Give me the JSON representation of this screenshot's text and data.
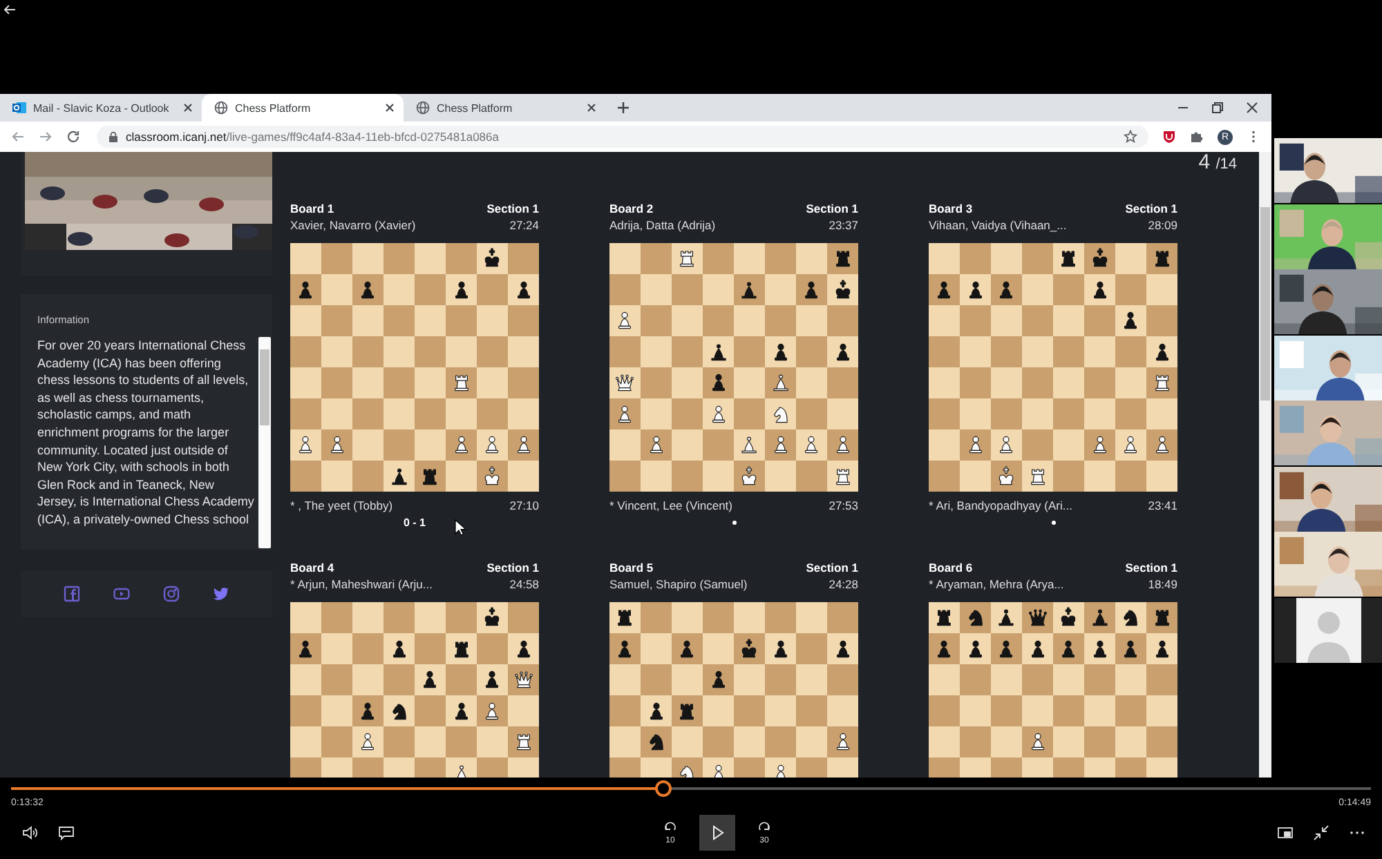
{
  "browser": {
    "tabs": [
      {
        "title": "Mail - Slavic Koza - Outlook",
        "kind": "mail",
        "selected": false
      },
      {
        "title": "Chess Platform",
        "kind": "web",
        "selected": true
      },
      {
        "title": "Chess Platform",
        "kind": "web",
        "selected": false
      }
    ],
    "address_host": "classroom.icanj.net",
    "address_path": "/live-games/ff9c4af4-83a4-11eb-bfcd-0275481a086a",
    "profile_initial": "R"
  },
  "sidebar": {
    "video": {
      "kind": "picture"
    },
    "information_title": "Information",
    "information_text": "For over 20 years International Chess Academy (ICA) has been offering chess lessons to students of all levels, as well as chess tournaments, scholastic camps, and math enrichment programs for the larger community. Located just outside of New York City, with schools in both Glen Rock and in Teaneck, New Jersey, is International Chess Academy (ICA), a privately-owned Chess school",
    "socials": [
      {
        "kind": "facebook"
      },
      {
        "kind": "youtube"
      },
      {
        "kind": "instagram"
      },
      {
        "kind": "twitter"
      }
    ]
  },
  "games": {
    "page": "4",
    "page_total": "/14",
    "boards": [
      {
        "title": "Board 1",
        "section": "Section 1",
        "top_player": "Xavier, Navarro (Xavier)",
        "top_clock": "27:24",
        "bottom_player": "* , The yeet (Tobby)",
        "bottom_clock": "27:10",
        "result": "0 - 1",
        "in_progress": false,
        "rows": [
          [
            {
              "kind": "empty"
            },
            {
              "kind": "empty"
            },
            {
              "kind": "empty"
            },
            {
              "kind": "empty"
            },
            {
              "kind": "empty"
            },
            {
              "kind": "empty"
            },
            {
              "kind": "king",
              "black": true
            },
            {
              "kind": "empty"
            }
          ],
          [
            {
              "kind": "pawn",
              "black": true
            },
            {
              "kind": "empty"
            },
            {
              "kind": "pawn",
              "black": true
            },
            {
              "kind": "empty"
            },
            {
              "kind": "empty"
            },
            {
              "kind": "pawn",
              "black": true
            },
            {
              "kind": "empty"
            },
            {
              "kind": "pawn",
              "black": true
            }
          ],
          [
            {
              "kind": "empty"
            },
            {
              "kind": "empty"
            },
            {
              "kind": "empty"
            },
            {
              "kind": "empty"
            },
            {
              "kind": "empty"
            },
            {
              "kind": "empty"
            },
            {
              "kind": "empty"
            },
            {
              "kind": "empty"
            }
          ],
          [
            {
              "kind": "empty"
            },
            {
              "kind": "empty"
            },
            {
              "kind": "empty"
            },
            {
              "kind": "empty"
            },
            {
              "kind": "empty"
            },
            {
              "kind": "empty"
            },
            {
              "kind": "empty"
            },
            {
              "kind": "empty"
            }
          ],
          [
            {
              "kind": "empty"
            },
            {
              "kind": "empty"
            },
            {
              "kind": "empty"
            },
            {
              "kind": "empty"
            },
            {
              "kind": "empty"
            },
            {
              "kind": "rook",
              "black": false
            },
            {
              "kind": "empty"
            },
            {
              "kind": "empty"
            }
          ],
          [
            {
              "kind": "empty"
            },
            {
              "kind": "empty"
            },
            {
              "kind": "empty"
            },
            {
              "kind": "empty"
            },
            {
              "kind": "empty"
            },
            {
              "kind": "empty"
            },
            {
              "kind": "empty"
            },
            {
              "kind": "empty"
            }
          ],
          [
            {
              "kind": "pawn",
              "black": false
            },
            {
              "kind": "pawn",
              "black": false
            },
            {
              "kind": "empty"
            },
            {
              "kind": "empty"
            },
            {
              "kind": "empty"
            },
            {
              "kind": "pawn",
              "black": false
            },
            {
              "kind": "pawn",
              "black": false
            },
            {
              "kind": "pawn",
              "black": false
            }
          ],
          [
            {
              "kind": "empty"
            },
            {
              "kind": "empty"
            },
            {
              "kind": "empty"
            },
            {
              "kind": "bishop",
              "black": true
            },
            {
              "kind": "rook",
              "black": true
            },
            {
              "kind": "empty"
            },
            {
              "kind": "king",
              "black": false
            },
            {
              "kind": "empty"
            }
          ]
        ]
      },
      {
        "title": "Board 2",
        "section": "Section 1",
        "top_player": "Adrija, Datta (Adrija)",
        "top_clock": "23:37",
        "bottom_player": "* Vincent, Lee (Vincent)",
        "bottom_clock": "27:53",
        "in_progress": true,
        "rows": [
          [
            {
              "kind": "empty"
            },
            {
              "kind": "empty"
            },
            {
              "kind": "rook",
              "black": false
            },
            {
              "kind": "empty"
            },
            {
              "kind": "empty"
            },
            {
              "kind": "empty"
            },
            {
              "kind": "empty"
            },
            {
              "kind": "rook",
              "black": true
            }
          ],
          [
            {
              "kind": "empty"
            },
            {
              "kind": "empty"
            },
            {
              "kind": "empty"
            },
            {
              "kind": "empty"
            },
            {
              "kind": "bishop",
              "black": true
            },
            {
              "kind": "empty"
            },
            {
              "kind": "pawn",
              "black": true
            },
            {
              "kind": "king",
              "black": true
            }
          ],
          [
            {
              "kind": "pawn",
              "black": false
            },
            {
              "kind": "empty"
            },
            {
              "kind": "empty"
            },
            {
              "kind": "empty"
            },
            {
              "kind": "empty"
            },
            {
              "kind": "empty"
            },
            {
              "kind": "empty"
            },
            {
              "kind": "empty"
            }
          ],
          [
            {
              "kind": "empty"
            },
            {
              "kind": "empty"
            },
            {
              "kind": "empty"
            },
            {
              "kind": "bishop",
              "black": true
            },
            {
              "kind": "empty"
            },
            {
              "kind": "pawn",
              "black": true
            },
            {
              "kind": "empty"
            },
            {
              "kind": "pawn",
              "black": true
            }
          ],
          [
            {
              "kind": "queen",
              "black": false
            },
            {
              "kind": "empty"
            },
            {
              "kind": "empty"
            },
            {
              "kind": "pawn",
              "black": true
            },
            {
              "kind": "empty"
            },
            {
              "kind": "bishop",
              "black": false
            },
            {
              "kind": "empty"
            },
            {
              "kind": "empty"
            }
          ],
          [
            {
              "kind": "pawn",
              "black": false
            },
            {
              "kind": "empty"
            },
            {
              "kind": "empty"
            },
            {
              "kind": "pawn",
              "black": false
            },
            {
              "kind": "empty"
            },
            {
              "kind": "knight",
              "black": false
            },
            {
              "kind": "empty"
            },
            {
              "kind": "empty"
            }
          ],
          [
            {
              "kind": "empty"
            },
            {
              "kind": "pawn",
              "black": false
            },
            {
              "kind": "empty"
            },
            {
              "kind": "empty"
            },
            {
              "kind": "bishop",
              "black": false
            },
            {
              "kind": "pawn",
              "black": false
            },
            {
              "kind": "pawn",
              "black": false
            },
            {
              "kind": "pawn",
              "black": false
            }
          ],
          [
            {
              "kind": "empty"
            },
            {
              "kind": "empty"
            },
            {
              "kind": "empty"
            },
            {
              "kind": "empty"
            },
            {
              "kind": "king",
              "black": false
            },
            {
              "kind": "empty"
            },
            {
              "kind": "empty"
            },
            {
              "kind": "rook",
              "black": false
            }
          ]
        ]
      },
      {
        "title": "Board 3",
        "section": "Section 1",
        "top_player": "Vihaan, Vaidya (Vihaan_...",
        "top_clock": "28:09",
        "bottom_player": "* Ari, Bandyopadhyay (Ari...",
        "bottom_clock": "23:41",
        "in_progress": true,
        "rows": [
          [
            {
              "kind": "empty"
            },
            {
              "kind": "empty"
            },
            {
              "kind": "empty"
            },
            {
              "kind": "empty"
            },
            {
              "kind": "rook",
              "black": true
            },
            {
              "kind": "king",
              "black": true
            },
            {
              "kind": "empty"
            },
            {
              "kind": "rook",
              "black": true
            }
          ],
          [
            {
              "kind": "pawn",
              "black": true
            },
            {
              "kind": "pawn",
              "black": true
            },
            {
              "kind": "pawn",
              "black": true
            },
            {
              "kind": "empty"
            },
            {
              "kind": "empty"
            },
            {
              "kind": "pawn",
              "black": true
            },
            {
              "kind": "empty"
            },
            {
              "kind": "empty"
            }
          ],
          [
            {
              "kind": "empty"
            },
            {
              "kind": "empty"
            },
            {
              "kind": "empty"
            },
            {
              "kind": "empty"
            },
            {
              "kind": "empty"
            },
            {
              "kind": "empty"
            },
            {
              "kind": "pawn",
              "black": true
            },
            {
              "kind": "empty"
            }
          ],
          [
            {
              "kind": "empty"
            },
            {
              "kind": "empty"
            },
            {
              "kind": "empty"
            },
            {
              "kind": "empty"
            },
            {
              "kind": "empty"
            },
            {
              "kind": "empty"
            },
            {
              "kind": "empty"
            },
            {
              "kind": "pawn",
              "black": true
            }
          ],
          [
            {
              "kind": "empty"
            },
            {
              "kind": "empty"
            },
            {
              "kind": "empty"
            },
            {
              "kind": "empty"
            },
            {
              "kind": "empty"
            },
            {
              "kind": "empty"
            },
            {
              "kind": "empty"
            },
            {
              "kind": "rook",
              "black": false
            }
          ],
          [
            {
              "kind": "empty"
            },
            {
              "kind": "empty"
            },
            {
              "kind": "empty"
            },
            {
              "kind": "empty"
            },
            {
              "kind": "empty"
            },
            {
              "kind": "empty"
            },
            {
              "kind": "empty"
            },
            {
              "kind": "empty"
            }
          ],
          [
            {
              "kind": "empty"
            },
            {
              "kind": "pawn",
              "black": false
            },
            {
              "kind": "pawn",
              "black": false
            },
            {
              "kind": "empty"
            },
            {
              "kind": "empty"
            },
            {
              "kind": "pawn",
              "black": false
            },
            {
              "kind": "pawn",
              "black": false
            },
            {
              "kind": "pawn",
              "black": false
            }
          ],
          [
            {
              "kind": "empty"
            },
            {
              "kind": "empty"
            },
            {
              "kind": "king",
              "black": false
            },
            {
              "kind": "rook",
              "black": false
            },
            {
              "kind": "empty"
            },
            {
              "kind": "empty"
            },
            {
              "kind": "empty"
            },
            {
              "kind": "empty"
            }
          ]
        ]
      },
      {
        "title": "Board 4",
        "section": "Section 1",
        "top_player": "* Arjun, Maheshwari (Arju...",
        "top_clock": "24:58",
        "rows": [
          [
            {
              "kind": "empty"
            },
            {
              "kind": "empty"
            },
            {
              "kind": "empty"
            },
            {
              "kind": "empty"
            },
            {
              "kind": "empty"
            },
            {
              "kind": "empty"
            },
            {
              "kind": "king",
              "black": true
            },
            {
              "kind": "empty"
            }
          ],
          [
            {
              "kind": "pawn",
              "black": true
            },
            {
              "kind": "empty"
            },
            {
              "kind": "empty"
            },
            {
              "kind": "pawn",
              "black": true
            },
            {
              "kind": "empty"
            },
            {
              "kind": "rook",
              "black": true
            },
            {
              "kind": "empty"
            },
            {
              "kind": "pawn",
              "black": true
            }
          ],
          [
            {
              "kind": "empty"
            },
            {
              "kind": "empty"
            },
            {
              "kind": "empty"
            },
            {
              "kind": "empty"
            },
            {
              "kind": "pawn",
              "black": true
            },
            {
              "kind": "empty"
            },
            {
              "kind": "pawn",
              "black": true
            },
            {
              "kind": "queen",
              "black": false
            }
          ],
          [
            {
              "kind": "empty"
            },
            {
              "kind": "empty"
            },
            {
              "kind": "pawn",
              "black": true
            },
            {
              "kind": "knight",
              "black": true
            },
            {
              "kind": "empty"
            },
            {
              "kind": "pawn",
              "black": true
            },
            {
              "kind": "pawn",
              "black": false
            },
            {
              "kind": "empty"
            }
          ],
          [
            {
              "kind": "empty"
            },
            {
              "kind": "empty"
            },
            {
              "kind": "pawn",
              "black": false
            },
            {
              "kind": "empty"
            },
            {
              "kind": "empty"
            },
            {
              "kind": "empty"
            },
            {
              "kind": "empty"
            },
            {
              "kind": "rook",
              "black": false
            }
          ],
          [
            {
              "kind": "empty"
            },
            {
              "kind": "empty"
            },
            {
              "kind": "empty"
            },
            {
              "kind": "empty"
            },
            {
              "kind": "empty"
            },
            {
              "kind": "bishop",
              "black": false
            },
            {
              "kind": "empty"
            },
            {
              "kind": "empty"
            }
          ]
        ]
      },
      {
        "title": "Board 5",
        "section": "Section 1",
        "top_player": "Samuel, Shapiro (Samuel)",
        "top_clock": "24:28",
        "rows": [
          [
            {
              "kind": "rook",
              "black": true
            },
            {
              "kind": "empty"
            },
            {
              "kind": "empty"
            },
            {
              "kind": "empty"
            },
            {
              "kind": "empty"
            },
            {
              "kind": "empty"
            },
            {
              "kind": "empty"
            },
            {
              "kind": "empty"
            }
          ],
          [
            {
              "kind": "pawn",
              "black": true
            },
            {
              "kind": "empty"
            },
            {
              "kind": "pawn",
              "black": true
            },
            {
              "kind": "empty"
            },
            {
              "kind": "king",
              "black": true
            },
            {
              "kind": "pawn",
              "black": true
            },
            {
              "kind": "empty"
            },
            {
              "kind": "pawn",
              "black": true
            }
          ],
          [
            {
              "kind": "empty"
            },
            {
              "kind": "empty"
            },
            {
              "kind": "empty"
            },
            {
              "kind": "pawn",
              "black": true
            },
            {
              "kind": "empty"
            },
            {
              "kind": "empty"
            },
            {
              "kind": "empty"
            },
            {
              "kind": "empty"
            }
          ],
          [
            {
              "kind": "empty"
            },
            {
              "kind": "pawn",
              "black": true
            },
            {
              "kind": "rook",
              "black": true
            },
            {
              "kind": "empty"
            },
            {
              "kind": "empty"
            },
            {
              "kind": "empty"
            },
            {
              "kind": "empty"
            },
            {
              "kind": "empty"
            }
          ],
          [
            {
              "kind": "empty"
            },
            {
              "kind": "knight",
              "black": true
            },
            {
              "kind": "empty"
            },
            {
              "kind": "empty"
            },
            {
              "kind": "empty"
            },
            {
              "kind": "empty"
            },
            {
              "kind": "empty"
            },
            {
              "kind": "pawn",
              "black": false
            }
          ],
          [
            {
              "kind": "empty"
            },
            {
              "kind": "empty"
            },
            {
              "kind": "knight",
              "black": false
            },
            {
              "kind": "pawn",
              "black": false
            },
            {
              "kind": "empty"
            },
            {
              "kind": "pawn",
              "black": false
            },
            {
              "kind": "empty"
            },
            {
              "kind": "empty"
            }
          ]
        ]
      },
      {
        "title": "Board 6",
        "section": "Section 1",
        "top_player": "* Aryaman, Mehra (Arya...",
        "top_clock": "18:49",
        "rows": [
          [
            {
              "kind": "rook",
              "black": true
            },
            {
              "kind": "knight",
              "black": true
            },
            {
              "kind": "bishop",
              "black": true
            },
            {
              "kind": "queen",
              "black": true
            },
            {
              "kind": "king",
              "black": true
            },
            {
              "kind": "bishop",
              "black": true
            },
            {
              "kind": "knight",
              "black": true
            },
            {
              "kind": "rook",
              "black": true
            }
          ],
          [
            {
              "kind": "pawn",
              "black": true
            },
            {
              "kind": "pawn",
              "black": true
            },
            {
              "kind": "pawn",
              "black": true
            },
            {
              "kind": "pawn",
              "black": true
            },
            {
              "kind": "pawn",
              "black": true
            },
            {
              "kind": "pawn",
              "black": true
            },
            {
              "kind": "pawn",
              "black": true
            },
            {
              "kind": "pawn",
              "black": true
            }
          ],
          [
            {
              "kind": "empty"
            },
            {
              "kind": "empty"
            },
            {
              "kind": "empty"
            },
            {
              "kind": "empty"
            },
            {
              "kind": "empty"
            },
            {
              "kind": "empty"
            },
            {
              "kind": "empty"
            },
            {
              "kind": "empty"
            }
          ],
          [
            {
              "kind": "empty"
            },
            {
              "kind": "empty"
            },
            {
              "kind": "empty"
            },
            {
              "kind": "empty"
            },
            {
              "kind": "empty"
            },
            {
              "kind": "empty"
            },
            {
              "kind": "empty"
            },
            {
              "kind": "empty"
            }
          ],
          [
            {
              "kind": "empty"
            },
            {
              "kind": "empty"
            },
            {
              "kind": "empty"
            },
            {
              "kind": "pawn",
              "black": false
            },
            {
              "kind": "empty"
            },
            {
              "kind": "empty"
            },
            {
              "kind": "empty"
            },
            {
              "kind": "empty"
            }
          ]
        ]
      }
    ]
  },
  "participants": [
    {
      "kind": "picture"
    },
    {
      "kind": "picture"
    },
    {
      "kind": "picture"
    },
    {
      "kind": "picture"
    },
    {
      "kind": "picture"
    },
    {
      "kind": "picture"
    },
    {
      "kind": "picture"
    },
    {
      "kind": "avatar"
    }
  ],
  "player": {
    "current_time": "0:13:32",
    "total_time": "0:14:49",
    "progress": {
      "level": 0.48
    },
    "skip_back": "10",
    "skip_forward": "30"
  }
}
